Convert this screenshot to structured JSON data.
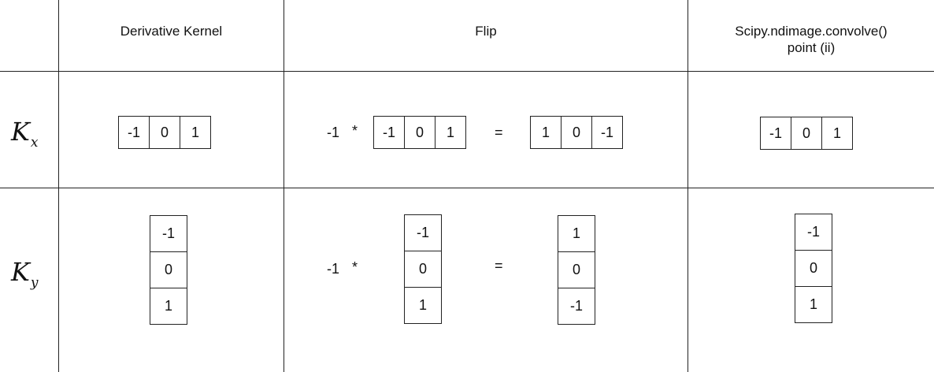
{
  "headers": {
    "derivative": "Derivative Kernel",
    "flip": "Flip",
    "scipy_line1": "Scipy.ndimage.convolve()",
    "scipy_line2": "point (ii)"
  },
  "rows": {
    "kx": {
      "symbol": "K",
      "subscript": "x"
    },
    "ky": {
      "symbol": "K",
      "subscript": "y"
    }
  },
  "kx": {
    "derivative": [
      "-1",
      "0",
      "1"
    ],
    "flip_factor": "-1",
    "flip_op": "*",
    "flip_input": [
      "-1",
      "0",
      "1"
    ],
    "equals": "=",
    "flip_result": [
      "1",
      "0",
      "-1"
    ],
    "scipy": [
      "-1",
      "0",
      "1"
    ]
  },
  "ky": {
    "derivative": [
      "-1",
      "0",
      "1"
    ],
    "flip_factor": "-1",
    "flip_op": "*",
    "flip_input": [
      "-1",
      "0",
      "1"
    ],
    "equals": "=",
    "flip_result": [
      "1",
      "0",
      "-1"
    ],
    "scipy": [
      "-1",
      "0",
      "1"
    ]
  }
}
